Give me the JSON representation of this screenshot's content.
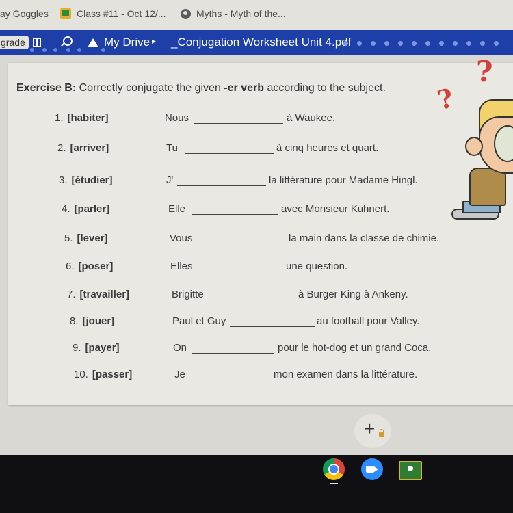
{
  "bookmarks": [
    {
      "label": "ay Goggles"
    },
    {
      "label": "Class #11 - Oct 12/...",
      "icon": "classroom-icon"
    },
    {
      "label": "Myths - Myth of the...",
      "icon": "globe-icon"
    }
  ],
  "toolbar": {
    "grade_label": "grade",
    "breadcrumb_root": "My Drive",
    "separator": "▸",
    "filename": "_Conjugation Worksheet Unit 4.pdf"
  },
  "worksheet": {
    "title_label": "Exercise B:",
    "instruction_pre": " Correctly conjugate the given ",
    "instruction_bold": "-er verb",
    "instruction_post": " according to the subject.",
    "items": [
      {
        "num": "1.",
        "verb": "[habiter]",
        "subject": "Nous",
        "rest": "à Waukee."
      },
      {
        "num": "2.",
        "verb": "[arriver]",
        "subject": "Tu",
        "rest": "à cinq heures et quart."
      },
      {
        "num": "3.",
        "verb": "[étudier]",
        "subject": "J'",
        "rest": "la littérature pour Madame Hingl."
      },
      {
        "num": "4.",
        "verb": "[parler]",
        "subject": "Elle",
        "rest": "avec Monsieur Kuhnert."
      },
      {
        "num": "5.",
        "verb": "[lever]",
        "subject": "Vous",
        "rest": "la main dans la classe de chimie."
      },
      {
        "num": "6.",
        "verb": "[poser]",
        "subject": "Elles",
        "rest": "une question."
      },
      {
        "num": "7.",
        "verb": "[travailler]",
        "subject": "Brigitte",
        "rest": "à Burger King à Ankeny."
      },
      {
        "num": "8.",
        "verb": "[jouer]",
        "subject": "Paul et Guy",
        "rest": "au football pour Valley."
      },
      {
        "num": "9.",
        "verb": "[payer]",
        "subject": "On",
        "rest": "pour le hot-dog et un grand Coca."
      },
      {
        "num": "10.",
        "verb": "[passer]",
        "subject": "Je",
        "rest": "mon examen dans la littérature."
      }
    ],
    "question_mark": "?"
  },
  "fab": {
    "symbol": "+",
    "icon": "lock-icon"
  },
  "shelf": {
    "apps": [
      "chrome-icon",
      "zoom-icon",
      "google-classroom-icon"
    ]
  }
}
